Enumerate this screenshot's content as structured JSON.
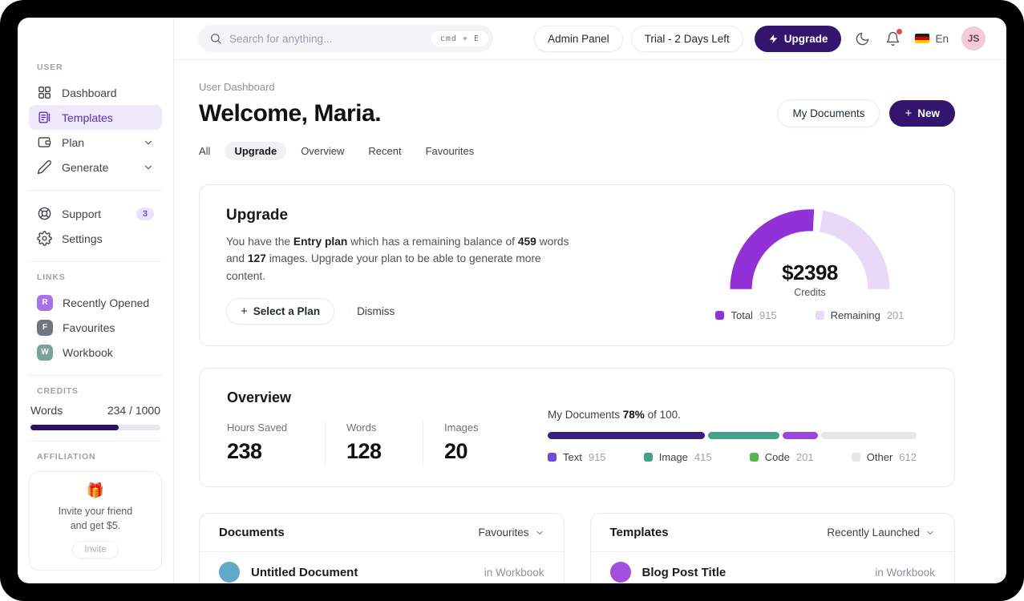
{
  "topbar": {
    "search": {
      "placeholder": "Search for anything...",
      "shortcut": "cmd + E"
    },
    "admin_panel_label": "Admin Panel",
    "trial_label": "Trial - 2 Days Left",
    "upgrade_label": "Upgrade",
    "language": "En",
    "avatar_initials": "JS"
  },
  "sidebar": {
    "user_section_label": "USER",
    "nav": [
      {
        "label": "Dashboard"
      },
      {
        "label": "Templates"
      },
      {
        "label": "Plan"
      },
      {
        "label": "Generate"
      }
    ],
    "support": {
      "label": "Support",
      "badge": "3"
    },
    "settings_label": "Settings",
    "links_section_label": "LINKS",
    "links": [
      {
        "label": "Recently Opened",
        "initial": "R",
        "color": "#a873e8"
      },
      {
        "label": "Favourites",
        "initial": "F",
        "color": "#6f7680"
      },
      {
        "label": "Workbook",
        "initial": "W",
        "color": "#7ba29a"
      }
    ],
    "credits_section_label": "CREDITS",
    "credits": {
      "label": "Words",
      "value": "234 / 1000",
      "percent": 68
    },
    "affiliation_section_label": "AFFILIATION",
    "affiliation": {
      "emoji": "🎁",
      "line1": "Invite your friend",
      "line2": "and get $5.",
      "button_label": "Invite"
    }
  },
  "header": {
    "breadcrumb": "User Dashboard",
    "title": "Welcome, Maria.",
    "my_documents_button": "My Documents",
    "new_button": "New",
    "tabs": [
      {
        "label": "All"
      },
      {
        "label": "Upgrade"
      },
      {
        "label": "Overview"
      },
      {
        "label": "Recent"
      },
      {
        "label": "Favourites"
      }
    ]
  },
  "upgrade_card": {
    "title": "Upgrade",
    "body_prefix": "You have the ",
    "plan_name": "Entry plan",
    "body_mid1": " which has a remaining balance of ",
    "words_balance": "459",
    "body_mid2": " words and ",
    "images_balance": "127",
    "body_suffix": " images. Upgrade your plan to be able to generate more content.",
    "select_plan_button": "Select a Plan",
    "dismiss_button": "Dismiss",
    "gauge_center_value": "$2398",
    "gauge_center_label": "Credits",
    "legend": [
      {
        "label": "Total",
        "value": "915"
      },
      {
        "label": "Remaining",
        "value": "201"
      }
    ]
  },
  "overview_card": {
    "title": "Overview",
    "stats": [
      {
        "label": "Hours Saved",
        "value": "238"
      },
      {
        "label": "Words",
        "value": "128"
      },
      {
        "label": "Images",
        "value": "20"
      }
    ],
    "progress_prefix": "My Documents ",
    "progress_percent": "78%",
    "progress_suffix": " of 100.",
    "legend": [
      {
        "label": "Text",
        "value": "915"
      },
      {
        "label": "Image",
        "value": "415"
      },
      {
        "label": "Code",
        "value": "201"
      },
      {
        "label": "Other",
        "value": "612"
      }
    ]
  },
  "documents_card": {
    "title": "Documents",
    "filter_label": "Favourites",
    "rows": [
      {
        "name": "Untitled Document",
        "location": "in Workbook",
        "color": "#5fa9c9"
      }
    ]
  },
  "templates_card": {
    "title": "Templates",
    "filter_label": "Recently Launched",
    "rows": [
      {
        "name": "Blog Post Title",
        "location": "in Workbook",
        "color": "#a44fe0"
      }
    ]
  },
  "chart_data": [
    {
      "type": "pie",
      "subtype": "half-donut-gauge",
      "title": "Credits",
      "center_value": "$2398",
      "center_label": "Credits",
      "series": [
        {
          "name": "Total",
          "value": 915,
          "color": "#9331d8"
        },
        {
          "name": "Remaining",
          "value": 201,
          "color": "#e7d9f7"
        }
      ],
      "legend_position": "bottom"
    },
    {
      "type": "bar",
      "subtype": "stacked-progress",
      "title": "My Documents 78% of 100.",
      "percent": 78,
      "max": 100,
      "series": [
        {
          "name": "Text",
          "value": 915,
          "color": "#38207e",
          "legend_color": "#6c4be0"
        },
        {
          "name": "Image",
          "value": 415,
          "color": "#43a287",
          "legend_color": "#43a287"
        },
        {
          "name": "Code",
          "value": 201,
          "color": "#9b47de",
          "legend_color": "#55b64a"
        },
        {
          "name": "Other",
          "value": 612,
          "color": "#e6e6ea",
          "legend_color": "#e6e6ea"
        }
      ],
      "legend_position": "bottom"
    }
  ]
}
